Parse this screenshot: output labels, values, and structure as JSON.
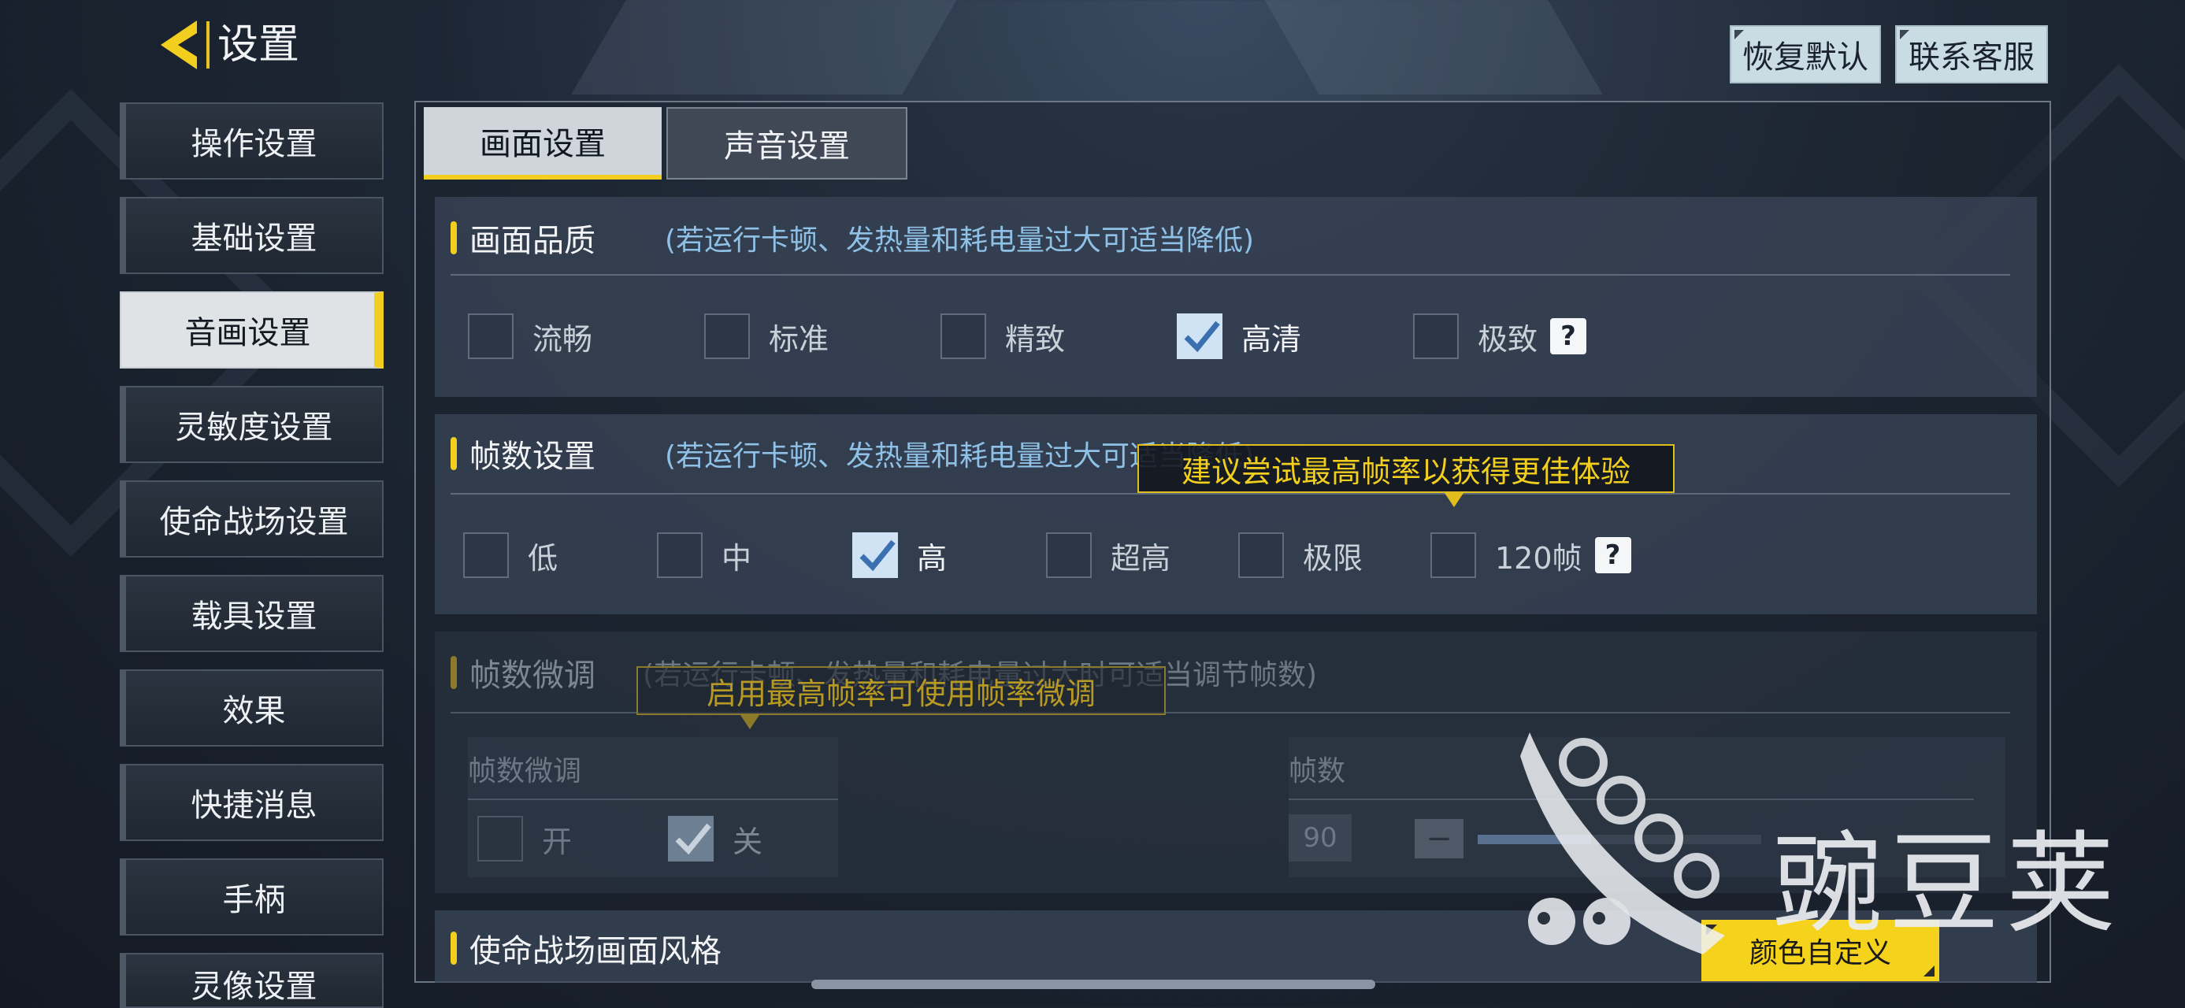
{
  "header": {
    "title": "设置",
    "restore_default": "恢复默认",
    "contact_service": "联系客服"
  },
  "sidebar": {
    "items": [
      {
        "label": "操作设置"
      },
      {
        "label": "基础设置"
      },
      {
        "label": "音画设置",
        "active": true
      },
      {
        "label": "灵敏度设置"
      },
      {
        "label": "使命战场设置"
      },
      {
        "label": "载具设置"
      },
      {
        "label": "效果"
      },
      {
        "label": "快捷消息"
      },
      {
        "label": "手柄"
      },
      {
        "label": "灵像设置"
      }
    ]
  },
  "tabs": [
    {
      "label": "画面设置",
      "active": true
    },
    {
      "label": "声音设置",
      "active": false
    }
  ],
  "quality": {
    "title": "画面品质",
    "hint": "(若运行卡顿、发热量和耗电量过大可适当降低)",
    "options": [
      {
        "label": "流畅",
        "checked": false
      },
      {
        "label": "标准",
        "checked": false
      },
      {
        "label": "精致",
        "checked": false
      },
      {
        "label": "高清",
        "checked": true
      },
      {
        "label": "极致",
        "checked": false
      }
    ],
    "help": "?"
  },
  "framerate": {
    "title": "帧数设置",
    "hint": "(若运行卡顿、发热量和耗电量过大可适当降低)",
    "tooltip": "建议尝试最高帧率以获得更佳体验",
    "options": [
      {
        "label": "低",
        "checked": false
      },
      {
        "label": "中",
        "checked": false
      },
      {
        "label": "高",
        "checked": true
      },
      {
        "label": "超高",
        "checked": false
      },
      {
        "label": "极限",
        "checked": false
      },
      {
        "label": "120帧",
        "checked": false
      }
    ],
    "help": "?"
  },
  "fine_tune": {
    "title": "帧数微调",
    "hint": "(若运行卡顿、发热量和耗电量过大时可适当调节帧数)",
    "tooltip": "启用最高帧率可使用帧率微调",
    "left_label": "帧数微调",
    "on_label": "开",
    "off_label": "关",
    "on_checked": false,
    "off_checked": true,
    "right_label": "帧数",
    "fps_value": "90",
    "minus": "−"
  },
  "style": {
    "title": "使命战场画面风格",
    "color_button": "颜色自定义"
  },
  "watermark": {
    "text": "豌豆荚"
  }
}
